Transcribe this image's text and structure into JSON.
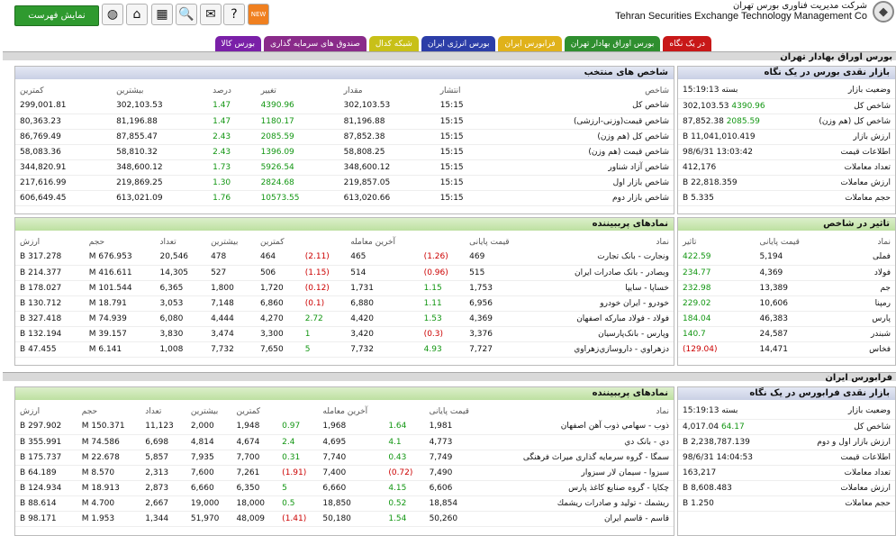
{
  "header": {
    "company_fa": "شرکت مدیریت فناوری بورس تهران",
    "company_en": "Tehran Securities Exchange Technology Management Co",
    "show_list": "نمایش فهرست"
  },
  "toolbar": [
    {
      "icon": "new-icon",
      "glyph": "NEW"
    },
    {
      "icon": "help-icon",
      "glyph": "?"
    },
    {
      "icon": "message-icon",
      "glyph": "✉"
    },
    {
      "icon": "search-icon",
      "glyph": "🔍"
    },
    {
      "icon": "table-icon",
      "glyph": "▦"
    },
    {
      "icon": "home-icon",
      "glyph": "⌂"
    },
    {
      "icon": "globe-icon",
      "glyph": "◍"
    }
  ],
  "tabs": [
    {
      "label": "در یک نگاه",
      "color": "#c81818"
    },
    {
      "label": "بورس اوراق بهادار تهران",
      "color": "#2f8f2f"
    },
    {
      "label": "فرابورس ایران",
      "color": "#e0b21a"
    },
    {
      "label": "بورس انرژی ایران",
      "color": "#2c3ea8"
    },
    {
      "label": "شبکه کدال",
      "color": "#c8c018"
    },
    {
      "label": "صندوق های سرمایه گذاری",
      "color": "#8a2b8a"
    },
    {
      "label": "بورس کالا",
      "color": "#7a20a8"
    }
  ],
  "tse": {
    "section_title": "بورس اوراق بهادار تهران",
    "market": {
      "title": "بازار نقدی بورس در یک نگاه",
      "rows": [
        {
          "label": "وضعیت بازار",
          "value": "بسته 15:19:13",
          "change": ""
        },
        {
          "label": "شاخص کل",
          "value": "302,103.53",
          "change": "4390.96"
        },
        {
          "label": "شاخص کل (هم وزن)",
          "value": "87,852.38",
          "change": "2085.59"
        },
        {
          "label": "ارزش بازار",
          "value": "11,041,010.419 B",
          "change": ""
        },
        {
          "label": "اطلاعات قیمت",
          "value": "13:03:42 98/6/31",
          "change": ""
        },
        {
          "label": "تعداد معاملات",
          "value": "412,176",
          "change": ""
        },
        {
          "label": "ارزش معاملات",
          "value": "22,818.359 B",
          "change": ""
        },
        {
          "label": "حجم معاملات",
          "value": "5.335 B",
          "change": ""
        }
      ]
    },
    "indices": {
      "title": "شاخص های منتخب",
      "headers": [
        "شاخص",
        "انتشار",
        "مقدار",
        "تغییر",
        "درصد",
        "بیشترین",
        "کمترین"
      ],
      "rows": [
        [
          "شاخص کل",
          "15:15",
          "302,103.53",
          "4390.96",
          "1.47",
          "302,103.53",
          "299,001.81"
        ],
        [
          "شاخص قیمت(وزنی-ارزشی)",
          "15:15",
          "81,196.88",
          "1180.17",
          "1.47",
          "81,196.88",
          "80,363.23"
        ],
        [
          "شاخص کل (هم وزن)",
          "15:15",
          "87,852.38",
          "2085.59",
          "2.43",
          "87,855.47",
          "86,769.49"
        ],
        [
          "شاخص قیمت (هم وزن)",
          "15:15",
          "58,808.25",
          "1396.09",
          "2.43",
          "58,810.32",
          "58,083.36"
        ],
        [
          "شاخص آزاد شناور",
          "15:15",
          "348,600.12",
          "5926.54",
          "1.73",
          "348,600.12",
          "344,820.91"
        ],
        [
          "شاخص بازار اول",
          "15:15",
          "219,857.05",
          "2824.68",
          "1.30",
          "219,869.25",
          "217,616.99"
        ],
        [
          "شاخص بازار دوم",
          "15:15",
          "613,020.66",
          "10573.55",
          "1.76",
          "613,021.09",
          "606,649.45"
        ]
      ]
    },
    "impact": {
      "title": "تاثیر در شاخص",
      "headers": [
        "نماد",
        "قیمت پایانی",
        "تاثیر"
      ],
      "rows": [
        [
          "فملی",
          "5,194",
          "422.59",
          "g"
        ],
        [
          "فولاد",
          "4,369",
          "234.77",
          "g"
        ],
        [
          "جم",
          "13,389",
          "232.98",
          "g"
        ],
        [
          "رمپنا",
          "10,606",
          "229.02",
          "g"
        ],
        [
          "پارس",
          "46,383",
          "184.04",
          "g"
        ],
        [
          "شبندر",
          "24,587",
          "140.7",
          "g"
        ],
        [
          "فخاس",
          "14,471",
          "(129.04)",
          "r"
        ]
      ]
    },
    "active": {
      "title": "نمادهای پرببیننده",
      "headers": [
        "نماد",
        "قیمت پایانی",
        "",
        "آخرین معامله",
        "",
        "کمترین",
        "بیشترین",
        "تعداد",
        "حجم",
        "ارزش"
      ],
      "rows": [
        [
          "ونجارت - بانک تجارت",
          "469",
          "(1.26)",
          "465",
          "(2.11)",
          "464",
          "478",
          "20,546",
          "676.953 M",
          "317.278 B",
          "r",
          "r"
        ],
        [
          "وبصادر - بانک صادرات ایران",
          "515",
          "(0.96)",
          "514",
          "(1.15)",
          "506",
          "527",
          "14,305",
          "416.611 M",
          "214.377 B",
          "r",
          "r"
        ],
        [
          "خساپا - سایپا",
          "1,753",
          "1.15",
          "1,731",
          "(0.12)",
          "1,720",
          "1,800",
          "6,365",
          "101.544 M",
          "178.027 B",
          "g",
          "r"
        ],
        [
          "خودرو - ایران خودرو",
          "6,956",
          "1.11",
          "6,880",
          "(0.1)",
          "6,860",
          "7,148",
          "3,053",
          "18.791 M",
          "130.712 B",
          "g",
          "r"
        ],
        [
          "فولاد - فولاد مبارکه اصفهان",
          "4,369",
          "1.53",
          "4,420",
          "2.72",
          "4,270",
          "4,444",
          "6,080",
          "74.939 M",
          "327.418 B",
          "g",
          "g"
        ],
        [
          "وپارس - بانک‌پارسیان",
          "3,376",
          "(0.3)",
          "3,420",
          "1",
          "3,300",
          "3,474",
          "3,830",
          "39.157 M",
          "132.194 B",
          "r",
          "g"
        ],
        [
          "دزهراوي - داروسازي‌زهراوي",
          "7,727",
          "4.93",
          "7,732",
          "5",
          "7,650",
          "7,732",
          "1,008",
          "6.141 M",
          "47.455 B",
          "g",
          "g"
        ]
      ]
    }
  },
  "ifb": {
    "section_title": "فرابورس ایران",
    "market": {
      "title": "بازار نقدی فرابورس در یک نگاه",
      "rows": [
        {
          "label": "وضعیت بازار",
          "value": "بسته 15:19:13",
          "change": ""
        },
        {
          "label": "شاخص کل",
          "value": "4,017.04",
          "change": "64.17"
        },
        {
          "label": "ارزش بازار اول و دوم",
          "value": "2,238,787.139 B",
          "change": ""
        },
        {
          "label": "اطلاعات قیمت",
          "value": "14:04:53 98/6/31",
          "change": ""
        },
        {
          "label": "تعداد معاملات",
          "value": "163,217",
          "change": ""
        },
        {
          "label": "ارزش معاملات",
          "value": "8,608.483 B",
          "change": ""
        },
        {
          "label": "حجم معاملات",
          "value": "1.250 B",
          "change": ""
        }
      ]
    },
    "active": {
      "title": "نمادهای پرببیننده",
      "headers": [
        "نماد",
        "قیمت پایانی",
        "",
        "آخرین معامله",
        "",
        "کمترین",
        "بیشترین",
        "تعداد",
        "حجم",
        "ارزش"
      ],
      "rows": [
        [
          "ذوب - سهامي ذوب آهن اصفهان",
          "1,981",
          "1.64",
          "1,968",
          "0.97",
          "1,948",
          "2,000",
          "11,123",
          "150.371 M",
          "297.902 B",
          "g",
          "g"
        ],
        [
          "دي - بانک دي",
          "4,773",
          "4.1",
          "4,695",
          "2.4",
          "4,674",
          "4,814",
          "6,698",
          "74.586 M",
          "355.991 B",
          "g",
          "g"
        ],
        [
          "سمگا - گروه سرمایه گذاری میراث فرهنگی",
          "7,749",
          "0.43",
          "7,740",
          "0.31",
          "7,700",
          "7,935",
          "5,857",
          "22.678 M",
          "175.737 B",
          "g",
          "g"
        ],
        [
          "سبزوا - سیمان لار سبزوار",
          "7,490",
          "(0.72)",
          "7,400",
          "(1.91)",
          "7,261",
          "7,600",
          "2,313",
          "8.570 M",
          "64.189 B",
          "r",
          "r"
        ],
        [
          "چکاپا - گروه صنايع کاغذ پارس",
          "6,606",
          "4.15",
          "6,660",
          "5",
          "6,350",
          "6,660",
          "2,873",
          "18.913 M",
          "124.934 B",
          "g",
          "g"
        ],
        [
          "ریشمك - تولید و صادرات ریشمك",
          "18,854",
          "0.52",
          "18,850",
          "0.5",
          "18,000",
          "19,000",
          "2,667",
          "4.700 M",
          "88.614 B",
          "g",
          "g"
        ],
        [
          "قاسم - قاسم ايران",
          "50,260",
          "1.54",
          "50,180",
          "(1.41)",
          "48,009",
          "51,970",
          "1,344",
          "1.953 M",
          "98.171 B",
          "g",
          "r"
        ]
      ]
    }
  }
}
